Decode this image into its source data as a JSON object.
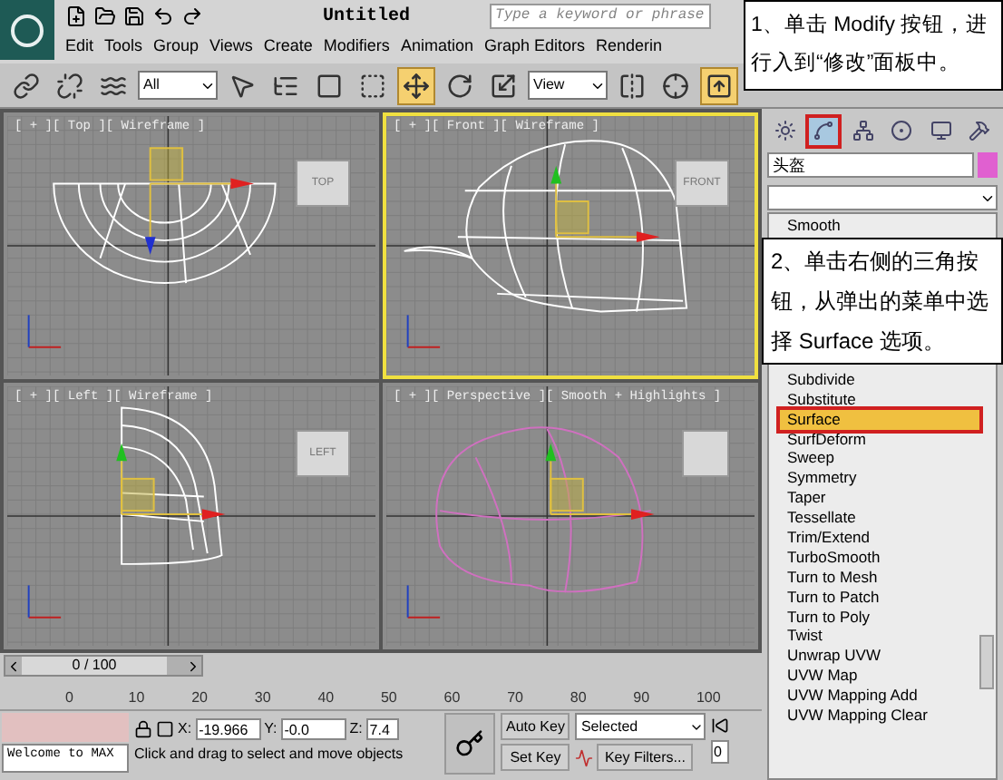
{
  "app": {
    "title": "Untitled",
    "search": {
      "placeholder": "Type a keyword or phrase"
    }
  },
  "menu": [
    "Edit",
    "Tools",
    "Group",
    "Views",
    "Create",
    "Modifiers",
    "Animation",
    "Graph Editors",
    "Renderin"
  ],
  "toolbar": [
    {
      "kind": "link",
      "selected": false
    },
    {
      "kind": "unlink",
      "selected": false
    },
    {
      "kind": "bind",
      "selected": false
    },
    {
      "kind": "dropdown",
      "value": "All"
    },
    {
      "kind": "select",
      "selected": false
    },
    {
      "kind": "select_by_name",
      "selected": false
    },
    {
      "kind": "region",
      "selected": false
    },
    {
      "kind": "crossing",
      "selected": false
    },
    {
      "kind": "move",
      "selected": true
    },
    {
      "kind": "rotate",
      "selected": false
    },
    {
      "kind": "scale",
      "selected": false
    },
    {
      "kind": "dropdown",
      "value": "View"
    },
    {
      "kind": "pivot",
      "selected": false
    },
    {
      "kind": "axis",
      "selected": false
    },
    {
      "kind": "manipulate",
      "selected": true
    }
  ],
  "callouts": [
    {
      "text": "1、单击 Modify 按钮，进行入到“修改”面板中。"
    },
    {
      "text": "2、单击右侧的三角按钮，从弹出的菜单中选择 Surface 选项。"
    }
  ],
  "viewports": [
    {
      "kind": "top",
      "label": "[ + ][ Top ][ Wireframe ]",
      "active": false,
      "cube": "TOP"
    },
    {
      "kind": "front",
      "label": "[ + ][ Front ][ Wireframe ]",
      "active": true,
      "cube": "FRONT"
    },
    {
      "kind": "left",
      "label": "[ + ][ Left ][ Wireframe ]",
      "active": false,
      "cube": "LEFT"
    },
    {
      "kind": "perspective",
      "label": "[ + ][ Perspective ][ Smooth + Highlights ]",
      "active": false
    }
  ],
  "command_panel": {
    "tabs": [
      {
        "kind": "create",
        "selected": false
      },
      {
        "kind": "modify",
        "selected": true
      },
      {
        "kind": "hierarchy",
        "selected": false
      },
      {
        "kind": "motion",
        "selected": false
      },
      {
        "kind": "display",
        "selected": false
      },
      {
        "kind": "utilities",
        "selected": false
      }
    ],
    "object_name": "头盔",
    "modifiers": [
      {
        "label": "Smooth",
        "selected": false
      },
      {
        "label": "Subdivide",
        "selected": false
      },
      {
        "label": "Substitute",
        "selected": false
      },
      {
        "label": "Surface",
        "selected": true
      },
      {
        "label": "SurfDeform",
        "selected": false
      },
      {
        "label": "Sweep",
        "selected": false
      },
      {
        "label": "Symmetry",
        "selected": false
      },
      {
        "label": "Taper",
        "selected": false
      },
      {
        "label": "Tessellate",
        "selected": false
      },
      {
        "label": "Trim/Extend",
        "selected": false
      },
      {
        "label": "TurboSmooth",
        "selected": false
      },
      {
        "label": "Turn to Mesh",
        "selected": false
      },
      {
        "label": "Turn to Patch",
        "selected": false
      },
      {
        "label": "Turn to Poly",
        "selected": false
      },
      {
        "label": "Twist",
        "selected": false
      },
      {
        "label": "Unwrap UVW",
        "selected": false
      },
      {
        "label": "UVW Map",
        "selected": false
      },
      {
        "label": "UVW Mapping Add",
        "selected": false
      },
      {
        "label": "UVW Mapping Clear",
        "selected": false
      }
    ]
  },
  "timeline": {
    "frame_label": "0 / 100",
    "ticks": [
      "0",
      "10",
      "20",
      "30",
      "40",
      "50",
      "60",
      "70",
      "80",
      "90",
      "100"
    ]
  },
  "status": {
    "listener": "Welcome to MAX",
    "coords": [
      {
        "axis": "X:",
        "value": "-19.966"
      },
      {
        "axis": "Y:",
        "value": "-0.0"
      },
      {
        "axis": "Z:",
        "value": "7.4"
      }
    ],
    "prompt": "Click and drag to select and move objects",
    "auto_key": "Auto Key",
    "set_key": "Set Key",
    "key_mode": "Selected",
    "key_filters": "Key Filters...",
    "frame": "0"
  }
}
